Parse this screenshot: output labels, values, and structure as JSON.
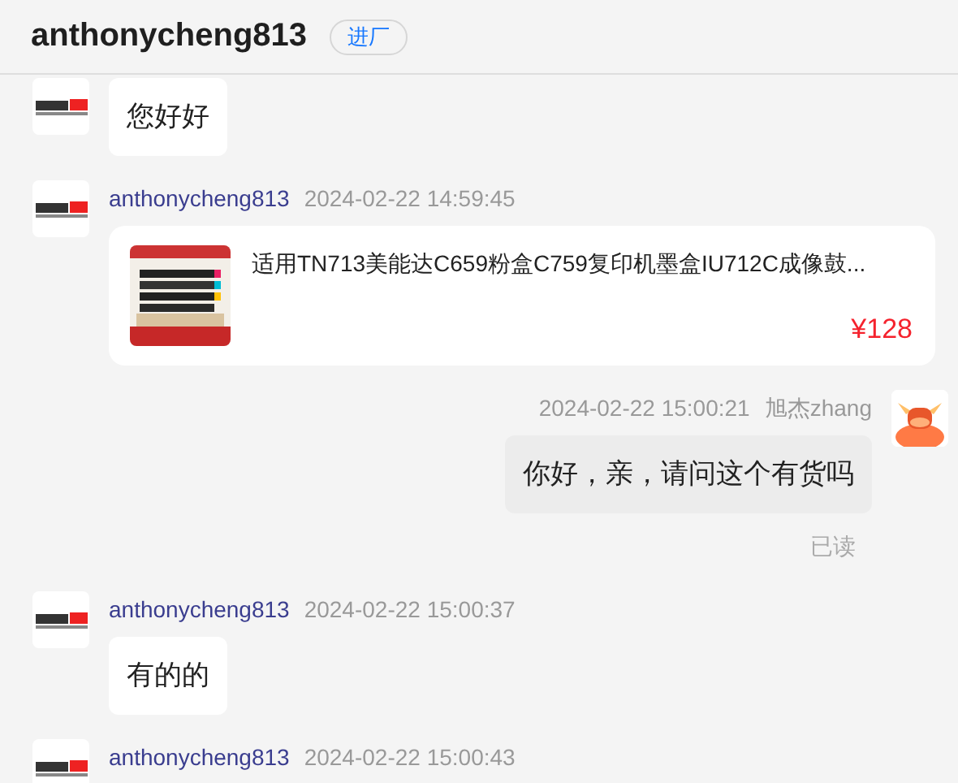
{
  "header": {
    "title": "anthonycheng813",
    "badge": "进厂"
  },
  "messages": [
    {
      "kind": "text",
      "outgoing": false,
      "text": "您好好"
    },
    {
      "kind": "product",
      "outgoing": false,
      "sender": "anthonycheng813",
      "time": "2024-02-22 14:59:45",
      "product": {
        "kind": "picture",
        "title": "适用TN713美能达C659粉盒C759复印机墨盒IU712C成像鼓...",
        "price": "¥128"
      }
    },
    {
      "kind": "text",
      "outgoing": true,
      "sender": "旭杰zhang",
      "time": "2024-02-22 15:00:21",
      "text": "你好，亲，请问这个有货吗",
      "status": "已读"
    },
    {
      "kind": "text",
      "outgoing": false,
      "sender": "anthonycheng813",
      "time": "2024-02-22 15:00:37",
      "text": "有的的"
    },
    {
      "kind": "header-only",
      "outgoing": false,
      "sender": "anthonycheng813",
      "time": "2024-02-22 15:00:43"
    }
  ]
}
